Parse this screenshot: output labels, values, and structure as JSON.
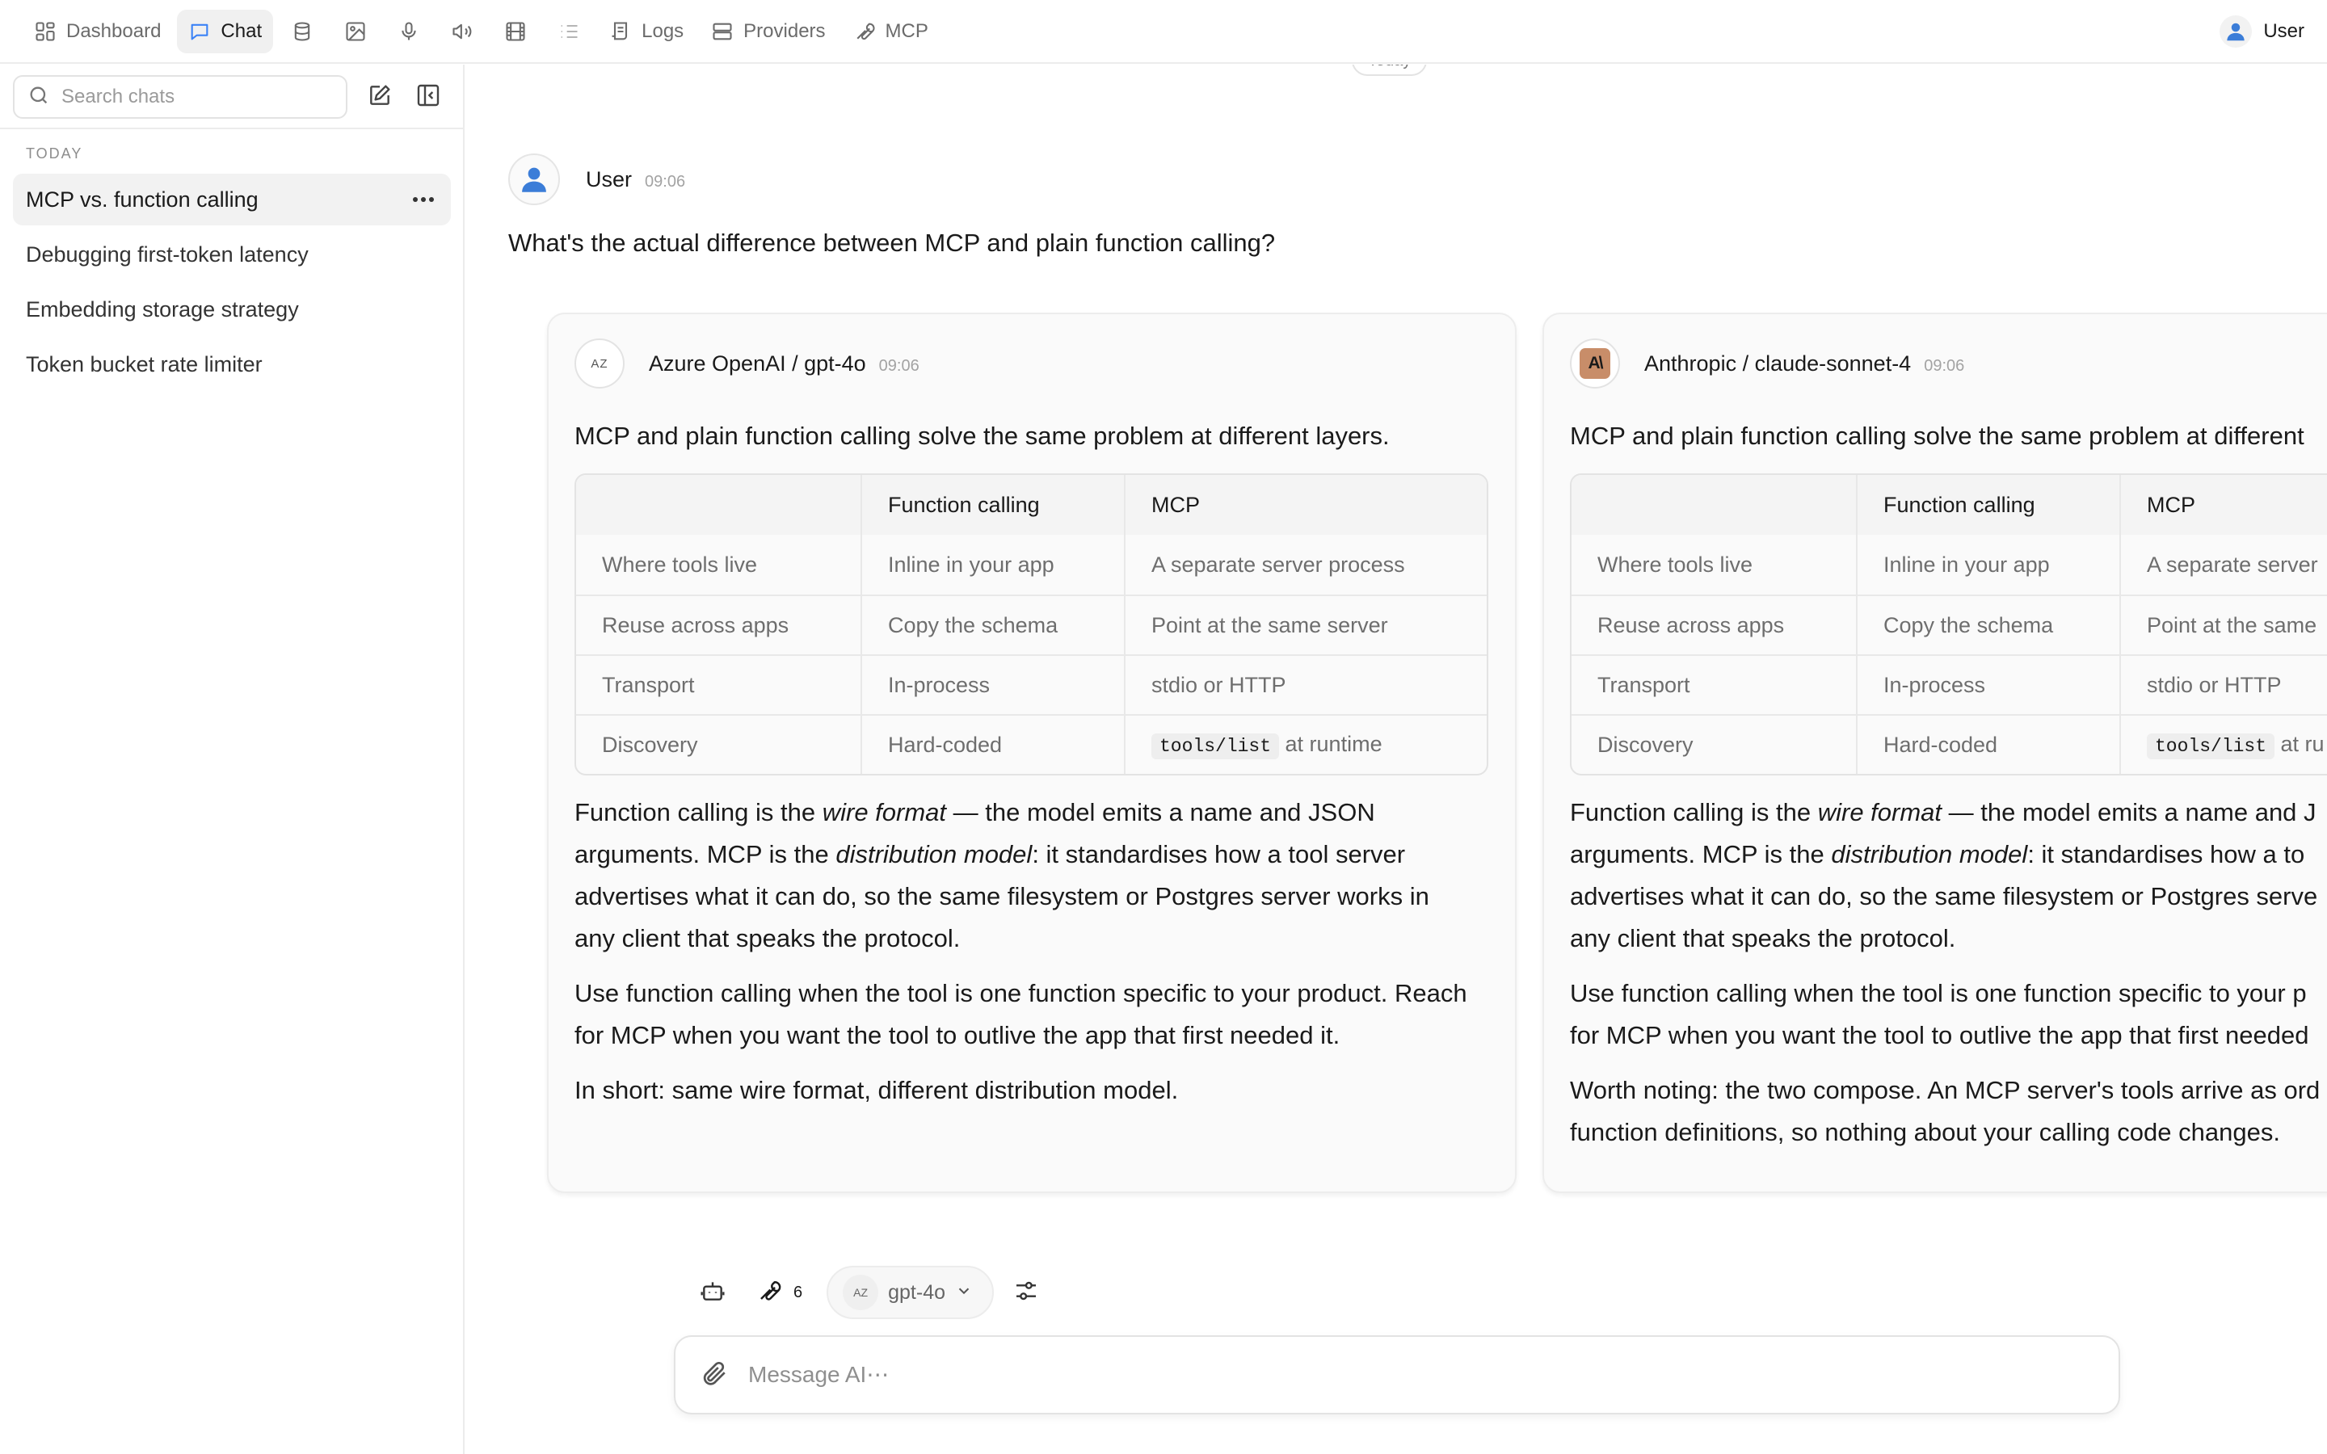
{
  "nav": {
    "items": [
      {
        "label": "Dashboard",
        "icon": "dashboard-icon"
      },
      {
        "label": "Chat",
        "icon": "chat-icon",
        "active": true
      },
      {
        "label": "",
        "icon": "database-icon"
      },
      {
        "label": "",
        "icon": "image-icon"
      },
      {
        "label": "",
        "icon": "microphone-icon"
      },
      {
        "label": "",
        "icon": "speaker-icon"
      },
      {
        "label": "",
        "icon": "film-icon"
      },
      {
        "label": "",
        "icon": "list-icon"
      },
      {
        "label": "Logs",
        "icon": "logs-icon"
      },
      {
        "label": "Providers",
        "icon": "providers-icon"
      },
      {
        "label": "MCP",
        "icon": "wrench-icon"
      }
    ],
    "user_label": "User"
  },
  "sidebar": {
    "search_placeholder": "Search chats",
    "section_label": "TODAY",
    "chats": [
      {
        "title": "MCP vs. function calling",
        "active": true
      },
      {
        "title": "Debugging first-token latency"
      },
      {
        "title": "Embedding storage strategy"
      },
      {
        "title": "Token bucket rate limiter"
      }
    ]
  },
  "conversation": {
    "day_label": "Today",
    "user_message": {
      "author": "User",
      "time": "09:06",
      "text": "What's the actual difference between MCP and plain function calling?"
    },
    "responses": [
      {
        "provider_badge": "AZ",
        "model": "Azure OpenAI / gpt-4o",
        "time": "09:06",
        "intro": "MCP and plain function calling solve the same problem at different layers.",
        "table": {
          "headers": [
            "",
            "Function calling",
            "MCP"
          ],
          "rows": [
            [
              "Where tools live",
              "Inline in your app",
              "A separate server process"
            ],
            [
              "Reuse across apps",
              "Copy the schema",
              "Point at the same server"
            ],
            [
              "Transport",
              "In-process",
              "stdio or HTTP"
            ],
            [
              "Discovery",
              "Hard-coded",
              "tools/list",
              " at runtime"
            ]
          ]
        },
        "p1": {
          "a": "Function calling is the ",
          "em1": "wire format",
          "b": " — the model emits a name and JSON",
          "c": "arguments. MCP is the ",
          "em2": "distribution model",
          "d": ": it standardises how a tool server",
          "e": "advertises what it can do, so the same filesystem or Postgres server works in",
          "f": "any client that speaks the protocol."
        },
        "p2_line1": "Use function calling when the tool is one function specific to your product. Reach",
        "p2_line2": "for MCP when you want the tool to outlive the app that first needed it.",
        "p3_line1": "In short: same wire format, different distribution model."
      },
      {
        "provider_badge": "A\\",
        "model": "Anthropic / claude-sonnet-4",
        "time": "09:06",
        "intro": "MCP and plain function calling solve the same problem at different",
        "table": {
          "headers": [
            "",
            "Function calling",
            "MCP"
          ],
          "rows": [
            [
              "Where tools live",
              "Inline in your app",
              "A separate server"
            ],
            [
              "Reuse across apps",
              "Copy the schema",
              "Point at the same"
            ],
            [
              "Transport",
              "In-process",
              "stdio or HTTP"
            ],
            [
              "Discovery",
              "Hard-coded",
              "tools/list",
              " at ru"
            ]
          ]
        },
        "p1": {
          "a": "Function calling is the ",
          "em1": "wire format",
          "b": " — the model emits a name and J",
          "c": "arguments. MCP is the ",
          "em2": "distribution model",
          "d": ": it standardises how a to",
          "e": "advertises what it can do, so the same filesystem or Postgres serve",
          "f": "any client that speaks the protocol."
        },
        "p2_line1": "Use function calling when the tool is one function specific to your p",
        "p2_line2": "for MCP when you want the tool to outlive the app that first needed",
        "p3_line1": "Worth noting: the two compose. An MCP server's tools arrive as ord",
        "p3_line2": "function definitions, so nothing about your calling code changes."
      }
    ]
  },
  "composer": {
    "tools_count": "6",
    "model_badge": "AZ",
    "model_label": "gpt-4o",
    "placeholder": "Message AI⋯"
  }
}
